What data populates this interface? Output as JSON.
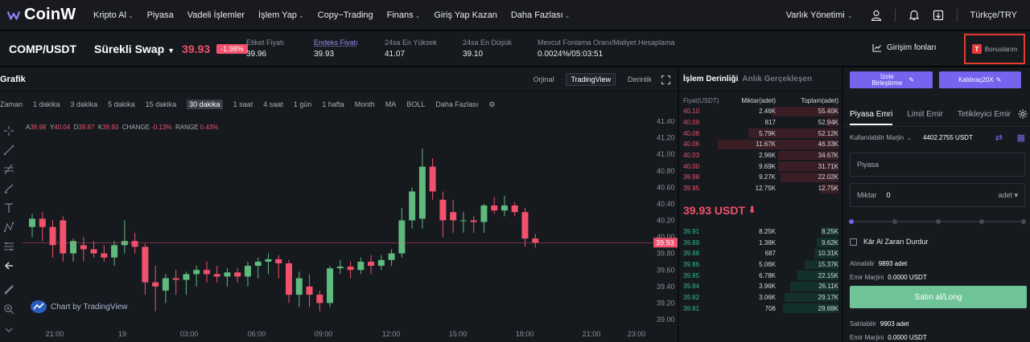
{
  "nav": {
    "brand": "CoinW",
    "items": [
      {
        "label": "Kripto Al",
        "chevron": true
      },
      {
        "label": "Piyasa",
        "chevron": false
      },
      {
        "label": "Vadeli İşlemler",
        "chevron": false
      },
      {
        "label": "İşlem Yap",
        "chevron": true
      },
      {
        "label": "Copy−Trading",
        "chevron": false
      },
      {
        "label": "Finans",
        "chevron": true
      },
      {
        "label": "Giriş Yap Kazan",
        "chevron": false
      },
      {
        "label": "Daha Fazlası",
        "chevron": true
      }
    ],
    "asset_management": "Varlık Yönetimi",
    "language": "Türkçe/TRY",
    "icons": [
      "user-icon",
      "bell-icon",
      "download-icon"
    ]
  },
  "ticker": {
    "pair": "COMP/USDT",
    "contract": "Sürekli Swap",
    "price": "39.93",
    "change": "-1.98%",
    "stats": [
      {
        "key": "Etiket Fiyatı",
        "value": "39.96",
        "link": false
      },
      {
        "key": "Endeks Fiyatı",
        "value": "39.93",
        "link": true
      },
      {
        "key": "24sa En Yüksek",
        "value": "41.07",
        "link": false
      },
      {
        "key": "24sa En Düşük",
        "value": "39.10",
        "link": false
      },
      {
        "key": "Mevcut Fonlama Oranı/Maliyet Hesaplama",
        "value": "0.0024%/05:03:51",
        "link": false
      }
    ],
    "funds": "Girişim fonları",
    "bonus": "Bonuslarım"
  },
  "chart": {
    "title": "Grafik",
    "views": [
      "Orjinal",
      "TradingView",
      "Derinlik"
    ],
    "active_view": "TradingView",
    "intervals": [
      "Zaman",
      "1 dakika",
      "3 dakika",
      "5 dakika",
      "15 dakika",
      "30 dakika",
      "1 saat",
      "4 saat",
      "1 gün",
      "1 hafta",
      "Month",
      "MA",
      "BOLL",
      "Daha Fazlası"
    ],
    "active_interval": "30 dakika",
    "ohlc": {
      "A": "39.98",
      "Y": "40.04",
      "D": "39.87",
      "K": "39.93",
      "change": "-0.13%",
      "range": "0.43%"
    },
    "watermark": "Chart by TradingView",
    "current_price_tag": "39.93"
  },
  "chart_data": {
    "type": "candlestick",
    "y_ticks": [
      "41.40",
      "41.20",
      "41.00",
      "40.80",
      "40.60",
      "40.40",
      "40.20",
      "40.00",
      "39.80",
      "39.60",
      "39.40",
      "39.20",
      "39.00"
    ],
    "ylim": [
      39.0,
      41.4
    ],
    "x_ticks": [
      "21:00",
      "19",
      "03:00",
      "06:00",
      "09:00",
      "12:00",
      "15:00",
      "18:00",
      "21:00",
      "23:00"
    ],
    "candles": [
      {
        "o": 40.12,
        "h": 40.28,
        "c": 40.22,
        "l": 40.0
      },
      {
        "o": 40.22,
        "h": 40.3,
        "c": 40.12,
        "l": 39.95
      },
      {
        "o": 40.12,
        "h": 40.2,
        "c": 39.9,
        "l": 39.75
      },
      {
        "o": 40.2,
        "h": 40.25,
        "c": 39.8,
        "l": 39.7
      },
      {
        "o": 39.8,
        "h": 39.98,
        "c": 39.95,
        "l": 39.7
      },
      {
        "o": 39.9,
        "h": 40.0,
        "c": 39.85,
        "l": 39.7
      },
      {
        "o": 39.85,
        "h": 39.95,
        "c": 39.8,
        "l": 39.75
      },
      {
        "o": 39.8,
        "h": 39.9,
        "c": 39.75,
        "l": 39.7
      },
      {
        "o": 39.75,
        "h": 39.95,
        "c": 39.9,
        "l": 39.65
      },
      {
        "o": 39.9,
        "h": 40.2,
        "c": 39.95,
        "l": 39.8
      },
      {
        "o": 39.95,
        "h": 40.05,
        "c": 39.88,
        "l": 39.8
      },
      {
        "o": 39.88,
        "h": 39.92,
        "c": 39.45,
        "l": 39.3
      },
      {
        "o": 39.45,
        "h": 39.65,
        "c": 39.4,
        "l": 39.1
      },
      {
        "o": 39.35,
        "h": 39.55,
        "c": 39.5,
        "l": 39.2
      },
      {
        "o": 39.5,
        "h": 39.6,
        "c": 39.48,
        "l": 39.3
      },
      {
        "o": 39.48,
        "h": 39.58,
        "c": 39.55,
        "l": 39.3
      },
      {
        "o": 39.55,
        "h": 39.65,
        "c": 39.6,
        "l": 39.4
      },
      {
        "o": 39.6,
        "h": 39.7,
        "c": 39.55,
        "l": 39.45
      },
      {
        "o": 39.55,
        "h": 39.65,
        "c": 39.52,
        "l": 39.45
      },
      {
        "o": 39.52,
        "h": 39.62,
        "c": 39.57,
        "l": 39.4
      },
      {
        "o": 39.57,
        "h": 39.62,
        "c": 39.52,
        "l": 39.45
      },
      {
        "o": 39.52,
        "h": 39.7,
        "c": 39.65,
        "l": 39.4
      },
      {
        "o": 39.65,
        "h": 39.75,
        "c": 39.7,
        "l": 39.5
      },
      {
        "o": 39.7,
        "h": 39.8,
        "c": 39.73,
        "l": 39.55
      },
      {
        "o": 39.73,
        "h": 39.78,
        "c": 39.68,
        "l": 39.5
      },
      {
        "o": 39.68,
        "h": 39.72,
        "c": 39.3,
        "l": 39.2
      },
      {
        "o": 39.3,
        "h": 39.58,
        "c": 39.5,
        "l": 39.15
      },
      {
        "o": 39.4,
        "h": 39.55,
        "c": 39.3,
        "l": 39.15
      },
      {
        "o": 39.3,
        "h": 39.35,
        "c": 39.2,
        "l": 39.1
      },
      {
        "o": 39.2,
        "h": 39.65,
        "c": 39.62,
        "l": 39.15
      },
      {
        "o": 39.62,
        "h": 39.72,
        "c": 39.64,
        "l": 39.55
      },
      {
        "o": 39.64,
        "h": 39.7,
        "c": 39.6,
        "l": 39.5
      },
      {
        "o": 39.6,
        "h": 39.75,
        "c": 39.7,
        "l": 39.55
      },
      {
        "o": 39.7,
        "h": 39.78,
        "c": 39.65,
        "l": 39.55
      },
      {
        "o": 39.65,
        "h": 39.78,
        "c": 39.72,
        "l": 39.6
      },
      {
        "o": 39.72,
        "h": 39.85,
        "c": 39.8,
        "l": 39.65
      },
      {
        "o": 39.8,
        "h": 40.35,
        "c": 40.2,
        "l": 39.75
      },
      {
        "o": 40.2,
        "h": 40.6,
        "c": 40.55,
        "l": 40.1
      },
      {
        "o": 40.22,
        "h": 41.07,
        "c": 40.85,
        "l": 40.1
      },
      {
        "o": 40.85,
        "h": 40.95,
        "c": 40.55,
        "l": 40.45
      },
      {
        "o": 40.45,
        "h": 40.55,
        "c": 40.2,
        "l": 40.0
      },
      {
        "o": 40.3,
        "h": 40.45,
        "c": 40.2,
        "l": 40.05
      },
      {
        "o": 40.2,
        "h": 40.3,
        "c": 40.2,
        "l": 40.05
      },
      {
        "o": 40.2,
        "h": 40.25,
        "c": 40.18,
        "l": 40.05
      },
      {
        "o": 40.18,
        "h": 40.4,
        "c": 40.38,
        "l": 40.05
      },
      {
        "o": 40.38,
        "h": 40.48,
        "c": 40.32,
        "l": 40.28
      },
      {
        "o": 40.32,
        "h": 40.5,
        "c": 40.38,
        "l": 40.25
      },
      {
        "o": 40.38,
        "h": 40.42,
        "c": 40.3,
        "l": 40.25
      },
      {
        "o": 40.3,
        "h": 40.35,
        "c": 39.98,
        "l": 39.88
      },
      {
        "o": 39.98,
        "h": 40.04,
        "c": 39.93,
        "l": 39.87
      }
    ]
  },
  "orderbook": {
    "tabs": [
      "İşlem Derinliği",
      "Anlık Gerçekleşen"
    ],
    "headers": [
      "Fiyat(USDT)",
      "Miktar(adet)",
      "Toplam(adet)"
    ],
    "asks": [
      [
        "40.10",
        "2.46K",
        "55.40K",
        0.55
      ],
      [
        "40.09",
        "817",
        "52.94K",
        0.1
      ],
      [
        "40.08",
        "5.79K",
        "52.12K",
        0.75
      ],
      [
        "40.06",
        "11.67K",
        "46.33K",
        1.0
      ],
      [
        "40.03",
        "2.96K",
        "34.67K",
        0.5
      ],
      [
        "40.00",
        "9.69K",
        "31.71K",
        0.5
      ],
      [
        "39.98",
        "9.27K",
        "22.02K",
        0.48
      ],
      [
        "39.95",
        "12.75K",
        "12.75K",
        0.15
      ]
    ],
    "last_price": "39.93 USDT",
    "bids": [
      [
        "39.91",
        "8.25K",
        "8.25K",
        0.15
      ],
      [
        "39.89",
        "1.38K",
        "9.62K",
        0.18
      ],
      [
        "39.88",
        "687",
        "10.31K",
        0.2
      ],
      [
        "39.86",
        "5.06K",
        "15.37K",
        0.28
      ],
      [
        "39.85",
        "6.78K",
        "22.15K",
        0.34
      ],
      [
        "39.84",
        "3.96K",
        "26.11K",
        0.4
      ],
      [
        "39.82",
        "3.06K",
        "29.17K",
        0.45
      ],
      [
        "39.81",
        "706",
        "29.88K",
        0.46
      ]
    ]
  },
  "order": {
    "copy_btn": "İzole Birleştirme",
    "leverage_btn": "Kaldıraç20X",
    "tabs": [
      "Piyasa Emri",
      "Limit Emir",
      "Tetikleyici Emir"
    ],
    "margin_label": "Kullanılabilir Marjin",
    "margin_value": "4402.2755 USDT",
    "price_placeholder": "Piyasa",
    "amount_label": "Miktar",
    "amount_value": "0",
    "unit": "adet",
    "tpsl": "Kâr Al Zararı Durdur",
    "buyable_label": "Alınabilir",
    "buyable_value": "9893 adet",
    "margin_req_label": "Emir Marjini",
    "margin_req_value": "0.0000 USDT",
    "buy_label": "Satın al/Long",
    "sellable_label": "Satılabilir",
    "sellable_value": "9903 adet",
    "margin_req_label2": "Emir Marjini",
    "margin_req_value2": "0.0000 USDT"
  },
  "colors": {
    "up": "#5fba7d",
    "down": "#f0516c",
    "accent": "#7464ee"
  }
}
